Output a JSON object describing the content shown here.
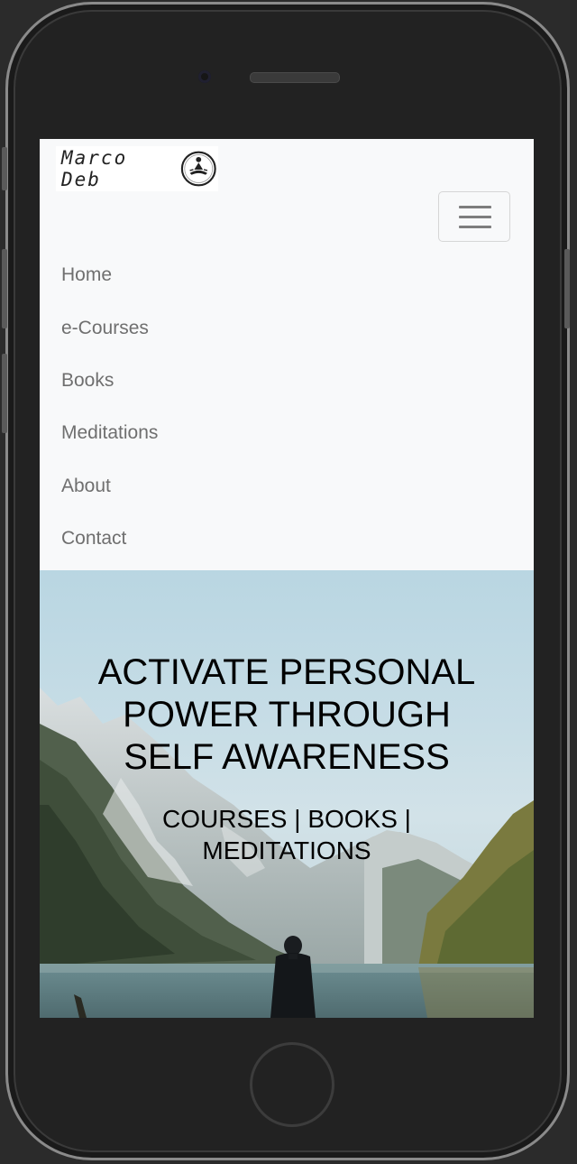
{
  "brand": {
    "name": "Marco Deb",
    "logo_icon": "meditation-figure-icon"
  },
  "navbar": {
    "toggler_icon": "hamburger-menu-icon",
    "items": [
      {
        "label": "Home"
      },
      {
        "label": "e-Courses"
      },
      {
        "label": "Books"
      },
      {
        "label": "Meditations"
      },
      {
        "label": "About"
      },
      {
        "label": "Contact"
      }
    ],
    "link_color": "#6f6f6f",
    "background": "#f8f9fa"
  },
  "hero": {
    "title": "ACTIVATE PERSONAL\nPOWER THROUGH\nSELF AWARENESS",
    "subtitle": "COURSES | BOOKS |\nMEDITATIONS",
    "image": "mountain-lake-person-image"
  }
}
